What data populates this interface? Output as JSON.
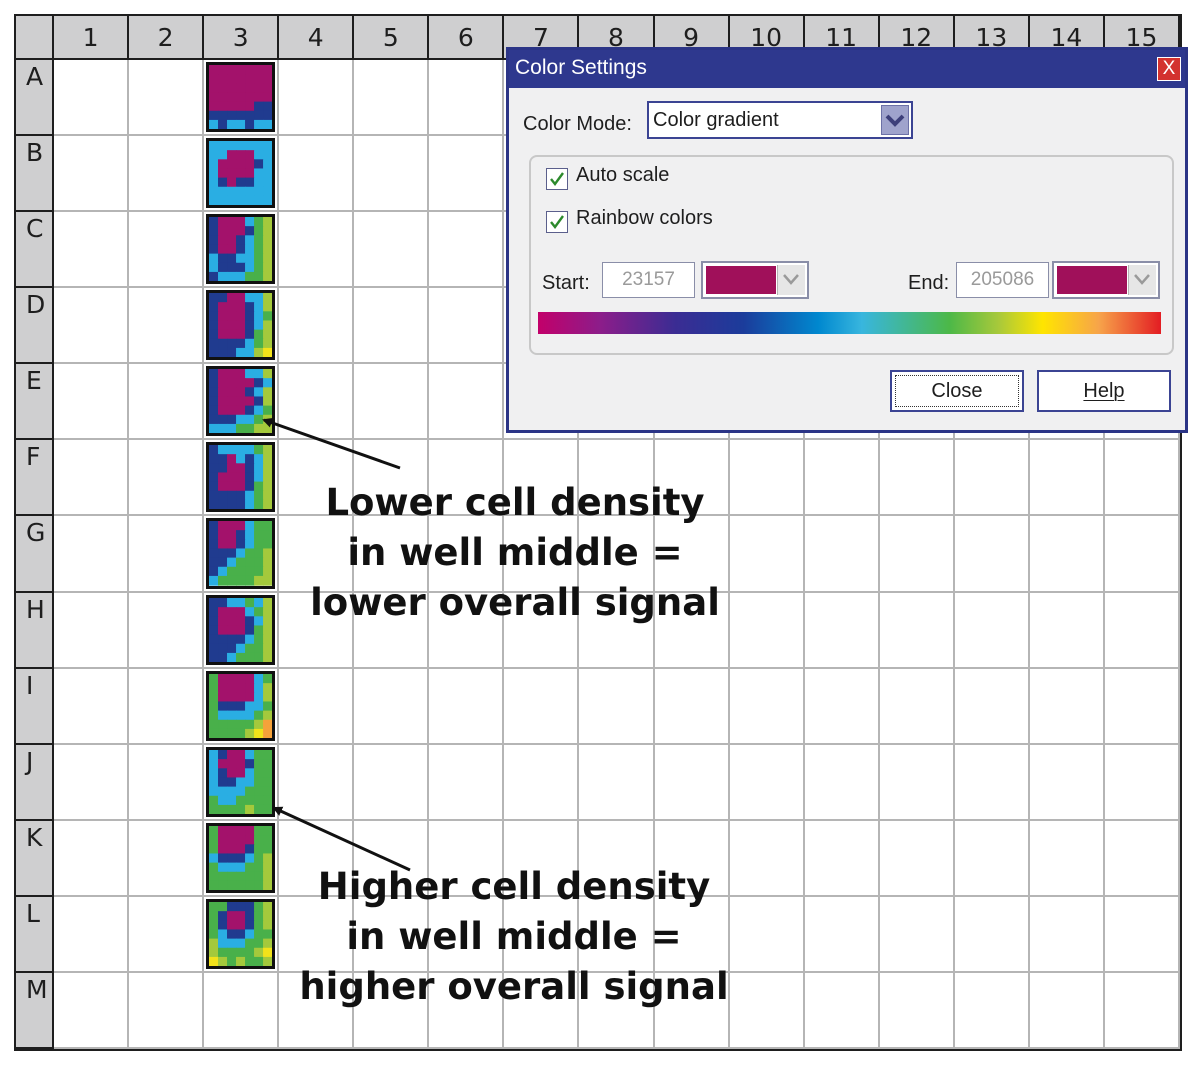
{
  "plate": {
    "columns": [
      "1",
      "2",
      "3",
      "4",
      "5",
      "6",
      "7",
      "8",
      "9",
      "10",
      "11",
      "12",
      "13",
      "14",
      "15"
    ],
    "rows": [
      "A",
      "B",
      "C",
      "D",
      "E",
      "F",
      "G",
      "H",
      "I",
      "J",
      "K",
      "L",
      "M"
    ],
    "well_images_column": "3",
    "well_images_rows": [
      "A",
      "B",
      "C",
      "D",
      "E",
      "F",
      "G",
      "H",
      "I",
      "J",
      "K",
      "L"
    ]
  },
  "dialog": {
    "title": "Color Settings",
    "close_symbol": "X",
    "color_mode_label": "Color Mode:",
    "color_mode_value": "Color gradient",
    "auto_scale_label": "Auto scale",
    "auto_scale_checked": true,
    "rainbow_label": "Rainbow colors",
    "rainbow_checked": true,
    "start_label": "Start:",
    "start_value": "23157",
    "start_color": "#a0105a",
    "end_label": "End:",
    "end_value": "205086",
    "end_color": "#a0105a",
    "close_button": "Close",
    "help_button": "Help"
  },
  "annotations": {
    "lower": [
      "Lower cell density",
      "in well middle =",
      "lower overall signal"
    ],
    "higher": [
      "Higher cell density",
      "in well middle =",
      "higher overall signal"
    ]
  },
  "colors": {
    "title_bar": "#2e388e",
    "header_gray": "#cfcfd0",
    "grid_line": "#b5b5b5"
  },
  "icons": {
    "checkmark": "checkmark-icon",
    "dropdown": "chevron-down-icon",
    "close": "close-icon"
  }
}
